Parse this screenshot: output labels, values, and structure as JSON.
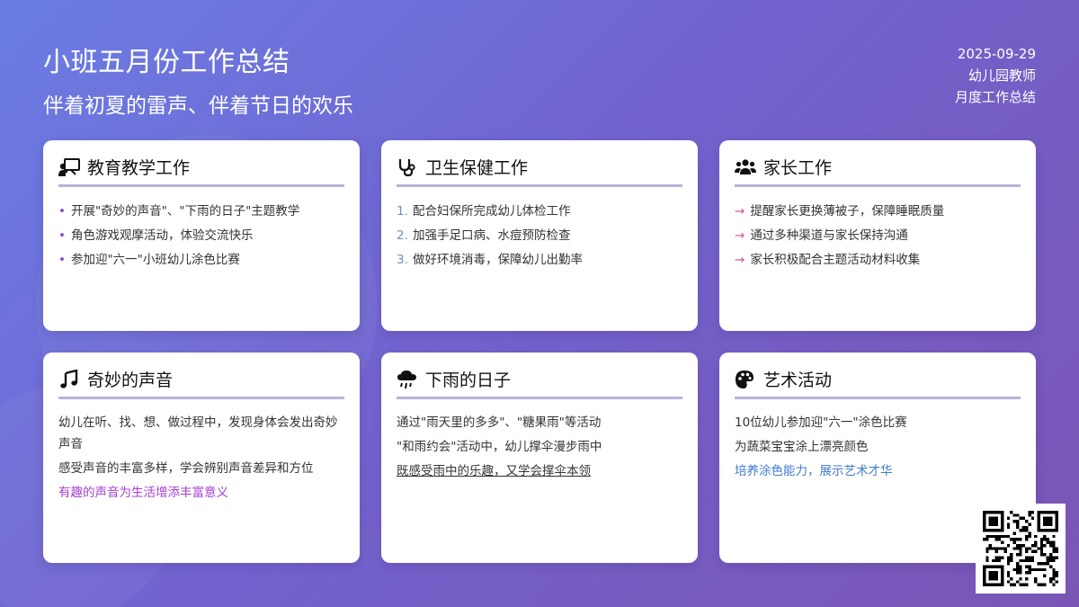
{
  "header": {
    "title": "小班五月份工作总结",
    "subtitle": "伴着初夏的雷声、伴着节日的欢乐",
    "date": "2025-09-29",
    "author": "幼儿园教师",
    "doc_type": "月度工作总结"
  },
  "cards": {
    "education": {
      "title": "教育教学工作",
      "icon": "teacher-board-icon",
      "items": [
        "开展\"奇妙的声音\"、\"下雨的日子\"主题教学",
        "角色游戏观摩活动，体验交流快乐",
        "参加迎\"六一\"小班幼儿涂色比赛"
      ]
    },
    "health": {
      "title": "卫生保健工作",
      "icon": "stethoscope-icon",
      "items": [
        "配合妇保所完成幼儿体检工作",
        "加强手足口病、水痘预防检查",
        "做好环境消毒，保障幼儿出勤率"
      ],
      "numbers": [
        "1.",
        "2.",
        "3."
      ]
    },
    "parents": {
      "title": "家长工作",
      "icon": "users-icon",
      "items": [
        "提醒家长更换薄被子，保障睡眠质量",
        "通过多种渠道与家长保持沟通",
        "家长积极配合主题活动材料收集"
      ]
    },
    "sound": {
      "title": "奇妙的声音",
      "icon": "music-note-icon",
      "paras": [
        "幼儿在听、找、想、做过程中，发现身体会发出奇妙声音",
        "感受声音的丰富多样，学会辨别声音差异和方位",
        "有趣的声音为生活增添丰富意义"
      ]
    },
    "rain": {
      "title": "下雨的日子",
      "icon": "cloud-rain-icon",
      "paras": [
        "通过\"雨天里的多多\"、\"糖果雨\"等活动",
        "\"和雨约会\"活动中，幼儿撑伞漫步雨中",
        "既感受雨中的乐趣，又学会撑伞本领"
      ]
    },
    "art": {
      "title": "艺术活动",
      "icon": "palette-icon",
      "paras": [
        "10位幼儿参加迎\"六一\"涂色比赛",
        "为蔬菜宝宝涂上漂亮颜色",
        "培养涂色能力，展示艺术才华"
      ]
    }
  },
  "colors": {
    "bg_start": "#6a7de3",
    "bg_end": "#7a55b4",
    "bullet": "#8a46c8",
    "arrow": "#d0479b",
    "number": "#6b8fc9",
    "accent_purple": "#a63fd1",
    "accent_blue": "#3f7bd0"
  },
  "qr_icon": "qr-code-icon"
}
